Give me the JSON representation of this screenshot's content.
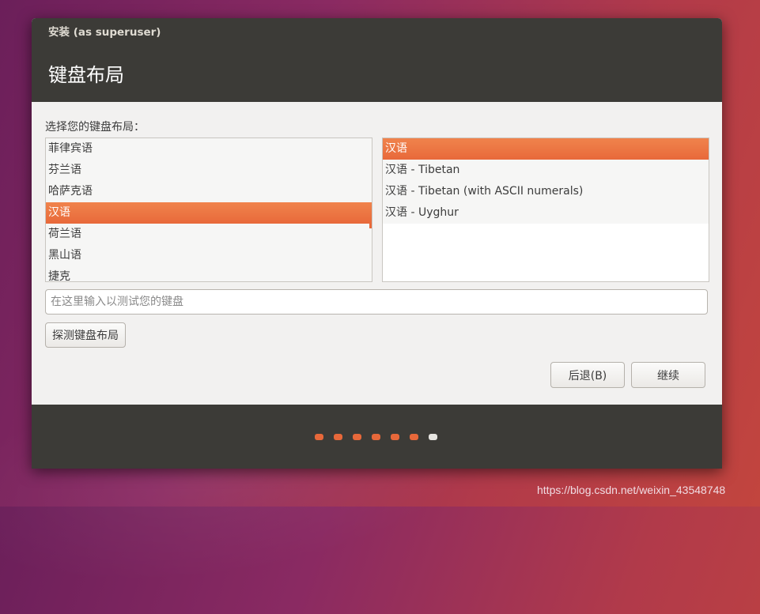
{
  "window": {
    "title": "安装 (as superuser)"
  },
  "page": {
    "title": "键盘布局"
  },
  "prompt": "选择您的键盘布局：",
  "layouts": [
    {
      "label": "菲律宾语",
      "selected": false
    },
    {
      "label": "芬兰语",
      "selected": false
    },
    {
      "label": "哈萨克语",
      "selected": false
    },
    {
      "label": "汉语",
      "selected": true
    },
    {
      "label": "荷兰语",
      "selected": false
    },
    {
      "label": "黑山语",
      "selected": false
    },
    {
      "label": "捷克",
      "selected": false
    }
  ],
  "variants": [
    {
      "label": "汉语",
      "selected": true
    },
    {
      "label": "汉语 - Tibetan",
      "selected": false
    },
    {
      "label": "汉语 - Tibetan (with ASCII numerals)",
      "selected": false
    },
    {
      "label": "汉语 - Uyghur",
      "selected": false
    }
  ],
  "test_input": {
    "placeholder": "在这里输入以测试您的键盘",
    "value": ""
  },
  "buttons": {
    "detect": "探测键盘布局",
    "back": "后退(B)",
    "next": "继续"
  },
  "progress": {
    "total_steps": 7,
    "current_step": 7
  },
  "colors": {
    "accent": "#e8693a",
    "header_bg": "#3c3b37",
    "window_bg": "#f2f1f0"
  },
  "watermark": "https://blog.csdn.net/weixin_43548748"
}
